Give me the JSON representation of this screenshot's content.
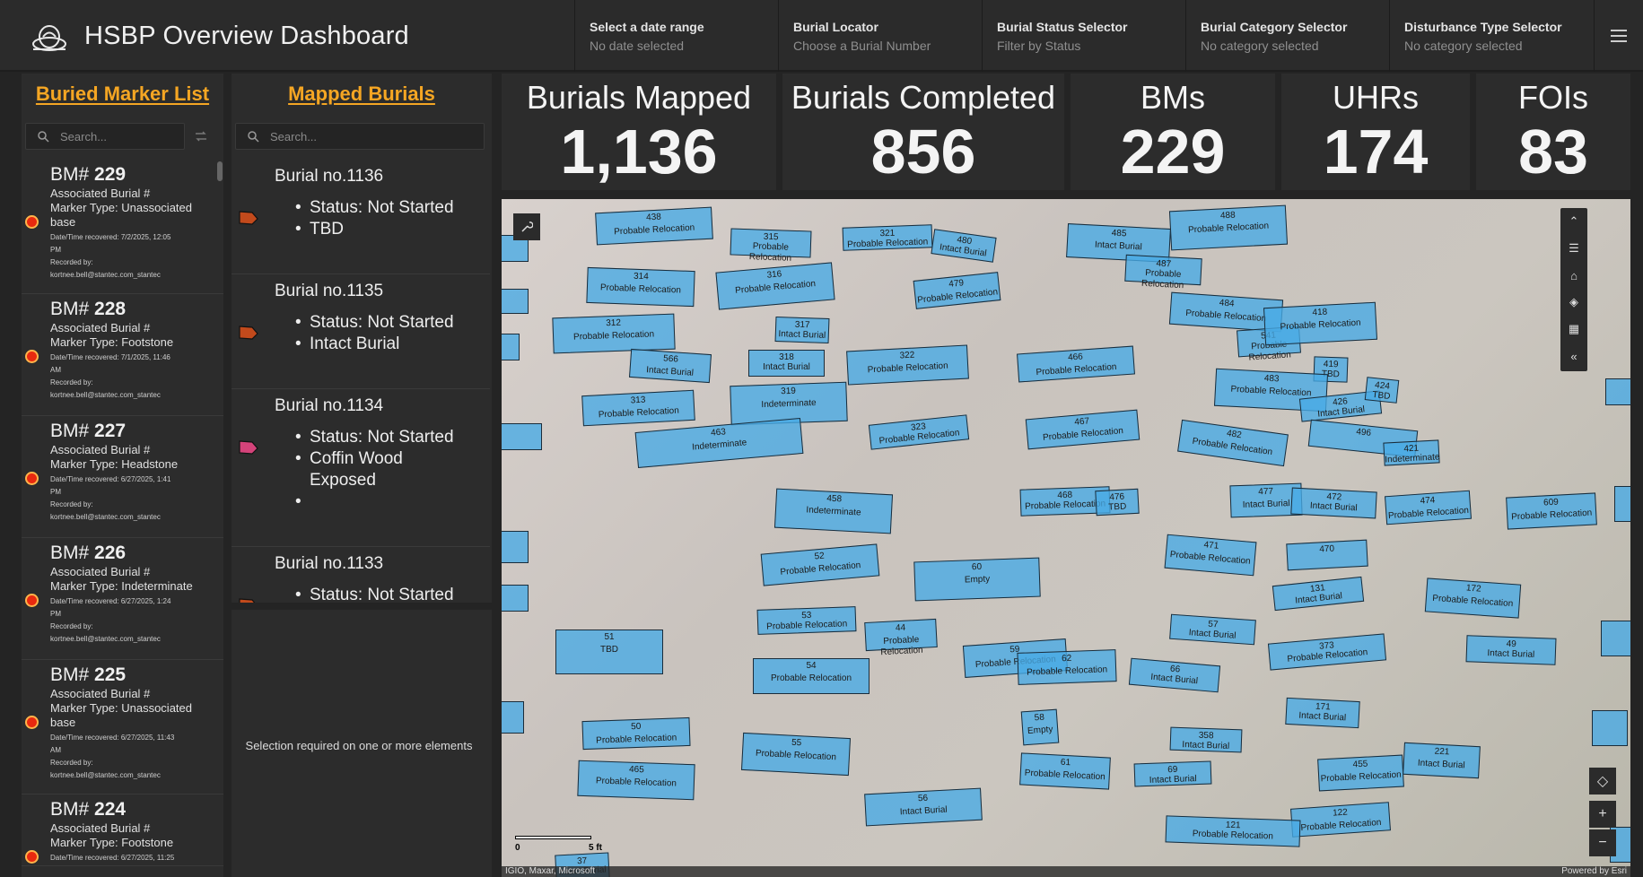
{
  "app": {
    "title": "HSBP Overview Dashboard"
  },
  "selectors": [
    {
      "title": "Select a date range",
      "value": "No date selected"
    },
    {
      "title": "Burial Locator",
      "value": "Choose a Burial Number"
    },
    {
      "title": "Burial Status Selector",
      "value": "Filter by Status"
    },
    {
      "title": "Burial Category Selector",
      "value": "No category selected"
    },
    {
      "title": "Disturbance Type Selector",
      "value": "No category selected"
    }
  ],
  "buried_marker_list": {
    "title": "Buried Marker List",
    "search_placeholder": "Search...",
    "items": [
      {
        "prefix": "BM#",
        "num": "229",
        "assoc": "Associated Burial #",
        "type": "Marker Type: Unassociated",
        "type2": "base",
        "date1": "Date/Time recovered: 7/2/2025, 12:05",
        "date2": "PM",
        "rec": "Recorded by:",
        "by": "kortnee.bell@stantec.com_stantec"
      },
      {
        "prefix": "BM#",
        "num": "228",
        "assoc": "Associated Burial #",
        "type": "Marker Type: Footstone",
        "type2": "",
        "date1": "Date/Time recovered: 7/1/2025, 11:46",
        "date2": "AM",
        "rec": "Recorded by:",
        "by": "kortnee.bell@stantec.com_stantec"
      },
      {
        "prefix": "BM#",
        "num": "227",
        "assoc": "Associated Burial #",
        "type": "Marker Type: Headstone",
        "type2": "",
        "date1": "Date/Time recovered: 6/27/2025, 1:41",
        "date2": "PM",
        "rec": "Recorded by:",
        "by": "kortnee.bell@stantec.com_stantec"
      },
      {
        "prefix": "BM#",
        "num": "226",
        "assoc": "Associated Burial #",
        "type": "Marker Type: Indeterminate",
        "type2": "",
        "date1": "Date/Time recovered: 6/27/2025, 1:24",
        "date2": "PM",
        "rec": "Recorded by:",
        "by": "kortnee.bell@stantec.com_stantec"
      },
      {
        "prefix": "BM#",
        "num": "225",
        "assoc": "Associated Burial #",
        "type": "Marker Type: Unassociated",
        "type2": "base",
        "date1": "Date/Time recovered: 6/27/2025, 11:43",
        "date2": "AM",
        "rec": "Recorded by:",
        "by": "kortnee.bell@stantec.com_stantec"
      },
      {
        "prefix": "BM#",
        "num": "224",
        "assoc": "Associated Burial #",
        "type": "Marker Type: Footstone",
        "type2": "",
        "date1": "Date/Time recovered: 6/27/2025, 11:25",
        "date2": "",
        "rec": "",
        "by": ""
      }
    ]
  },
  "mapped_burials": {
    "title": "Mapped Burials",
    "search_placeholder": "Search...",
    "items": [
      {
        "name": "Burial no.1136",
        "status": "Status: Not Started",
        "detail": "TBD",
        "detail2": "",
        "extra": "",
        "color": "#c24a1c"
      },
      {
        "name": "Burial no.1135",
        "status": "Status: Not Started",
        "detail": "Intact Burial",
        "detail2": "",
        "extra": "",
        "color": "#c24a1c"
      },
      {
        "name": "Burial no.1134",
        "status": "Status: Not Started",
        "detail": "Coffin Wood",
        "detail2": "Exposed",
        "extra": "",
        "color": "#d4437a"
      },
      {
        "name": "Burial no.1133",
        "status": "Status: Not Started",
        "detail": "",
        "detail2": "",
        "extra": "",
        "color": "#c24a1c"
      }
    ],
    "selection_message": "Selection required on one or more elements"
  },
  "indicators": [
    {
      "label": "Burials Mapped",
      "value": "1,136"
    },
    {
      "label": "Burials Completed",
      "value": "856"
    },
    {
      "label": "BMs",
      "value": "229"
    },
    {
      "label": "UHRs",
      "value": "174"
    },
    {
      "label": "FOIs",
      "value": "83"
    }
  ],
  "map": {
    "attribution": "IGIO, Maxar, Microsoft",
    "powered": "Powered by Esri",
    "scale_label": "5 ft",
    "scale_zero": "0",
    "polygons": [
      {
        "n": "438",
        "t": "Probable Relocation"
      },
      {
        "n": "315",
        "t": "Probable Relocation"
      },
      {
        "n": "321",
        "t": "Probable Relocation"
      },
      {
        "n": "480",
        "t": "Intact Burial"
      },
      {
        "n": "485",
        "t": "Intact Burial"
      },
      {
        "n": "488",
        "t": "Probable Relocation"
      },
      {
        "n": "314",
        "t": "Probable Relocation"
      },
      {
        "n": "316",
        "t": "Probable Relocation"
      },
      {
        "n": "479",
        "t": "Probable Relocation"
      },
      {
        "n": "487",
        "t": "Probable Relocation"
      },
      {
        "n": "312",
        "t": "Probable Relocation"
      },
      {
        "n": "317",
        "t": "Intact Burial"
      },
      {
        "n": "484",
        "t": "Probable Relocation"
      },
      {
        "n": "541",
        "t": "Probable Relocation"
      },
      {
        "n": "418",
        "t": "Probable Relocation"
      },
      {
        "n": "566",
        "t": "Intact Burial"
      },
      {
        "n": "318",
        "t": "Intact Burial"
      },
      {
        "n": "322",
        "t": "Probable Relocation"
      },
      {
        "n": "466",
        "t": "Probable Relocation"
      },
      {
        "n": "419",
        "t": "TBD"
      },
      {
        "n": "313",
        "t": "Probable Relocation"
      },
      {
        "n": "319",
        "t": "Indeterminate"
      },
      {
        "n": "483",
        "t": "Probable Relocation"
      },
      {
        "n": "426",
        "t": "Intact Burial"
      },
      {
        "n": "424",
        "t": "TBD"
      },
      {
        "n": "463",
        "t": "Indeterminate"
      },
      {
        "n": "323",
        "t": "Probable Relocation"
      },
      {
        "n": "467",
        "t": "Probable Relocation"
      },
      {
        "n": "482",
        "t": "Probable Relocation"
      },
      {
        "n": "496",
        "t": ""
      },
      {
        "n": "421",
        "t": "Indeterminate"
      },
      {
        "n": "458",
        "t": "Indeterminate"
      },
      {
        "n": "468",
        "t": "Probable Relocation"
      },
      {
        "n": "476",
        "t": "TBD"
      },
      {
        "n": "477",
        "t": "Intact Burial"
      },
      {
        "n": "472",
        "t": "Intact Burial"
      },
      {
        "n": "474",
        "t": "Probable Relocation"
      },
      {
        "n": "609",
        "t": "Probable Relocation"
      },
      {
        "n": "52",
        "t": "Probable Relocation"
      },
      {
        "n": "60",
        "t": "Empty"
      },
      {
        "n": "471",
        "t": "Probable Relocation"
      },
      {
        "n": "470",
        "t": ""
      },
      {
        "n": "131",
        "t": "Intact Burial"
      },
      {
        "n": "172",
        "t": "Probable Relocation"
      },
      {
        "n": "53",
        "t": "Probable Relocation"
      },
      {
        "n": "44",
        "t": "Probable Relocation"
      },
      {
        "n": "51",
        "t": "TBD"
      },
      {
        "n": "59",
        "t": "Probable Relocation"
      },
      {
        "n": "57",
        "t": "Intact Burial"
      },
      {
        "n": "373",
        "t": "Probable Relocation"
      },
      {
        "n": "49",
        "t": "Intact Burial"
      },
      {
        "n": "54",
        "t": "Probable Relocation"
      },
      {
        "n": "62",
        "t": "Probable Relocation"
      },
      {
        "n": "66",
        "t": "Intact Burial"
      },
      {
        "n": "50",
        "t": "Probable Relocation"
      },
      {
        "n": "58",
        "t": "Empty"
      },
      {
        "n": "358",
        "t": "Intact Burial"
      },
      {
        "n": "171",
        "t": "Intact Burial"
      },
      {
        "n": "55",
        "t": "Probable Relocation"
      },
      {
        "n": "465",
        "t": "Probable Relocation"
      },
      {
        "n": "61",
        "t": "Probable Relocation"
      },
      {
        "n": "69",
        "t": "Intact Burial"
      },
      {
        "n": "455",
        "t": "Probable Relocation"
      },
      {
        "n": "221",
        "t": "Intact Burial"
      },
      {
        "n": "56",
        "t": "Intact Burial"
      },
      {
        "n": "122",
        "t": "Probable Relocation"
      },
      {
        "n": "121",
        "t": "Probable Relocation"
      },
      {
        "n": "37",
        "t": "Intact Burial"
      }
    ]
  }
}
